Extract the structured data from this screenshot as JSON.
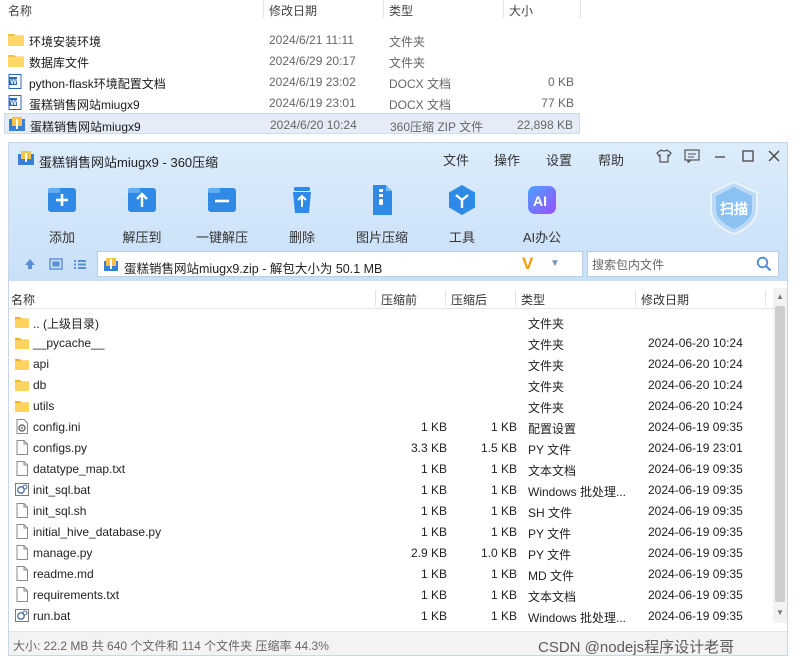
{
  "explorer": {
    "columns": {
      "name": "名称",
      "date": "修改日期",
      "type": "类型",
      "size": "大小"
    },
    "rows": [
      {
        "name": "环境安装环境",
        "date": "2024/6/21 11:11",
        "type": "文件夹",
        "size": "",
        "icon": "folder-icon"
      },
      {
        "name": "数据库文件",
        "date": "2024/6/29 20:17",
        "type": "文件夹",
        "size": "",
        "icon": "folder-icon"
      },
      {
        "name": "python-flask环境配置文档",
        "date": "2024/6/19 23:02",
        "type": "DOCX 文档",
        "size": "0 KB",
        "icon": "word-doc-icon"
      },
      {
        "name": "蛋糕销售网站miugx9",
        "date": "2024/6/19 23:01",
        "type": "DOCX 文档",
        "size": "77 KB",
        "icon": "word-doc-icon"
      },
      {
        "name": "蛋糕销售网站miugx9",
        "date": "2024/6/20 10:24",
        "type": "360压缩 ZIP 文件",
        "size": "22,898 KB",
        "icon": "zip-archive-icon",
        "selected": true
      }
    ]
  },
  "window": {
    "title": "蛋糕销售网站miugx9 - 360压缩",
    "menu": [
      "文件",
      "操作",
      "设置",
      "帮助"
    ],
    "toolbar": [
      {
        "label": "添加",
        "icon": "add-icon",
        "color": "#1e88e5"
      },
      {
        "label": "解压到",
        "icon": "extract-to-icon",
        "color": "#1e88e5"
      },
      {
        "label": "一键解压",
        "icon": "one-click-extract-icon",
        "color": "#1e88e5"
      },
      {
        "label": "删除",
        "icon": "delete-icon",
        "color": "#1e88e5"
      },
      {
        "label": "图片压缩",
        "icon": "image-compress-icon",
        "color": "#1e88e5"
      },
      {
        "label": "工具",
        "icon": "tools-icon",
        "color": "#1e88e5"
      },
      {
        "label": "AI办公",
        "icon": "ai-office-icon",
        "color": "#8a4dff"
      }
    ],
    "scan_label": "扫描",
    "address": "蛋糕销售网站miugx9.zip - 解包大小为 50.1 MB",
    "address_badge": "V",
    "search_placeholder": "搜索包内文件",
    "list_columns": {
      "name": "名称",
      "packed": "压缩前",
      "compressed": "压缩后",
      "type": "类型",
      "date": "修改日期"
    },
    "files": [
      {
        "name": ".. (上级目录)",
        "packed": "",
        "compressed": "",
        "type": "文件夹",
        "date": "",
        "icon": "folder"
      },
      {
        "name": "__pycache__",
        "packed": "",
        "compressed": "",
        "type": "文件夹",
        "date": "2024-06-20 10:24",
        "icon": "folder"
      },
      {
        "name": "api",
        "packed": "",
        "compressed": "",
        "type": "文件夹",
        "date": "2024-06-20 10:24",
        "icon": "folder"
      },
      {
        "name": "db",
        "packed": "",
        "compressed": "",
        "type": "文件夹",
        "date": "2024-06-20 10:24",
        "icon": "folder"
      },
      {
        "name": "utils",
        "packed": "",
        "compressed": "",
        "type": "文件夹",
        "date": "2024-06-20 10:24",
        "icon": "folder"
      },
      {
        "name": "config.ini",
        "packed": "1 KB",
        "compressed": "1 KB",
        "type": "配置设置",
        "date": "2024-06-19 09:35",
        "icon": "settings"
      },
      {
        "name": "configs.py",
        "packed": "3.3 KB",
        "compressed": "1.5 KB",
        "type": "PY 文件",
        "date": "2024-06-19 23:01",
        "icon": "file"
      },
      {
        "name": "datatype_map.txt",
        "packed": "1 KB",
        "compressed": "1 KB",
        "type": "文本文档",
        "date": "2024-06-19 09:35",
        "icon": "file"
      },
      {
        "name": "init_sql.bat",
        "packed": "1 KB",
        "compressed": "1 KB",
        "type": "Windows 批处理...",
        "date": "2024-06-19 09:35",
        "icon": "batch"
      },
      {
        "name": "init_sql.sh",
        "packed": "1 KB",
        "compressed": "1 KB",
        "type": "SH 文件",
        "date": "2024-06-19 09:35",
        "icon": "file"
      },
      {
        "name": "initial_hive_database.py",
        "packed": "1 KB",
        "compressed": "1 KB",
        "type": "PY 文件",
        "date": "2024-06-19 09:35",
        "icon": "file"
      },
      {
        "name": "manage.py",
        "packed": "2.9 KB",
        "compressed": "1.0 KB",
        "type": "PY 文件",
        "date": "2024-06-19 09:35",
        "icon": "file"
      },
      {
        "name": "readme.md",
        "packed": "1 KB",
        "compressed": "1 KB",
        "type": "MD 文件",
        "date": "2024-06-19 09:35",
        "icon": "file"
      },
      {
        "name": "requirements.txt",
        "packed": "1 KB",
        "compressed": "1 KB",
        "type": "文本文档",
        "date": "2024-06-19 09:35",
        "icon": "file"
      },
      {
        "name": "run.bat",
        "packed": "1 KB",
        "compressed": "1 KB",
        "type": "Windows 批处理...",
        "date": "2024-06-19 09:35",
        "icon": "batch"
      }
    ],
    "status": "大小: 22.2 MB 共 640 个文件和 114 个文件夹 压缩率 44.3%"
  },
  "watermark": "CSDN @nodejs程序设计老哥"
}
